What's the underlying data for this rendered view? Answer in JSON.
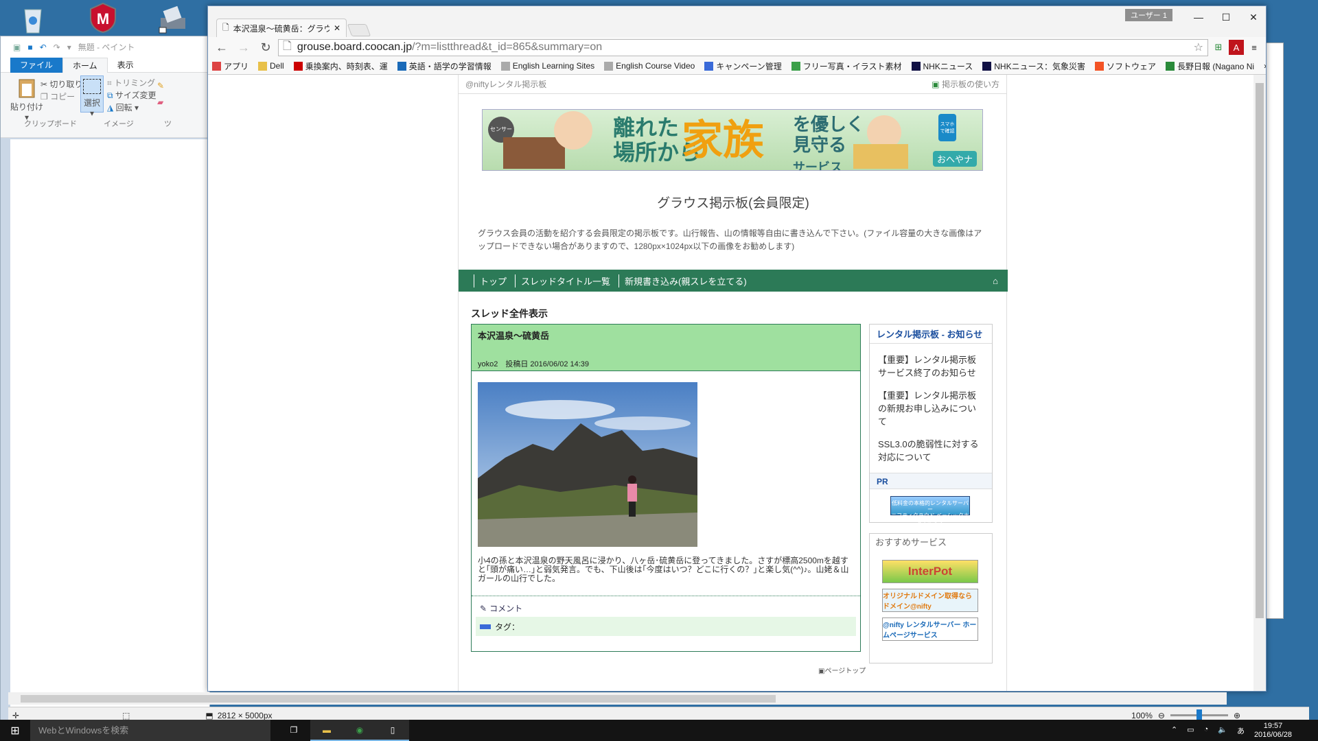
{
  "paint": {
    "title": "無題 - ペイント",
    "tabs": [
      "ファイル",
      "ホーム",
      "表示"
    ],
    "clipboard": {
      "paste": "貼り付け",
      "cut": "切り取り",
      "copy": "コピー",
      "group": "クリップボード"
    },
    "image": {
      "select": "選択",
      "trim": "トリミング",
      "resize": "サイズ変更",
      "rotate": "回転",
      "group": "イメージ"
    },
    "tool_group_partial": "ツ",
    "canvas_size": "2812 × 5000px",
    "zoom": "100%",
    "zoom_level": 0.5
  },
  "chrome": {
    "tab_title": "本沢温泉～硫黄岳：グラウ",
    "user": "ユーザー 1",
    "url_host": "grouse.board.coocan.jp",
    "url_path": "/?m=listthread&t_id=865&summary=on",
    "bookmarks": [
      {
        "icon": "apps-icon",
        "label": "アプリ"
      },
      {
        "icon": "folder-icon",
        "label": "Dell"
      },
      {
        "icon": "yahoo-icon",
        "label": "乗換案内、時刻表、運"
      },
      {
        "icon": "dict-icon",
        "label": "英語・語学の学習情報"
      },
      {
        "icon": "page-icon",
        "label": "English Learning Sites"
      },
      {
        "icon": "page-icon",
        "label": "English Course Video"
      },
      {
        "icon": "campaign-icon",
        "label": "キャンペーン管理"
      },
      {
        "icon": "photo-icon",
        "label": "フリー写真・イラスト素材"
      },
      {
        "icon": "nhk-icon",
        "label": "NHKニュース"
      },
      {
        "icon": "nhk-icon",
        "label": "NHKニュース：気象災害"
      },
      {
        "icon": "windows-icon",
        "label": "ソフトウェア"
      },
      {
        "icon": "news-icon",
        "label": "長野日報 (Nagano Ni"
      }
    ]
  },
  "page": {
    "topbar_left": "@niftyレンタル掲示板",
    "topbar_right": "掲示板の使い方",
    "banner": {
      "t1": "離れた",
      "t2": "場所から",
      "t3": "家族",
      "t4": "を優しく",
      "t5": "見守る",
      "t6": "サービス",
      "sensor": "センサー",
      "phone": "スマホで確認",
      "brand": "おへやナ"
    },
    "title": "グラウス掲示板(会員限定)",
    "desc": "グラウス会員の活動を紹介する会員限定の掲示板です。山行報告、山の情報等自由に書き込んで下さい。(ファイル容量の大きな画像はアップロードできない場合がありますので、1280px×1024px以下の画像をお勧めします)",
    "nav": [
      "トップ",
      "スレッドタイトル一覧",
      "新規書き込み(親スレを立てる)"
    ],
    "section": "スレッド全件表示",
    "post": {
      "title": "本沢温泉～硫黄岳",
      "meta": "yoko2　投稿日 2016/06/02 14:39",
      "body": "小4の孫と本沢温泉の野天風呂に浸かり、八ヶ岳･硫黄岳に登ってきました。さすが標高2500mを越すと｢頭が痛い…｣と弱気発言。でも、下山後は｢今度はいつ？どこに行くの？｣と楽し気(^^)♪。山姥＆山ガールの山行でした。",
      "comment": "コメント",
      "tag": "タグ："
    },
    "pagetop": "ページトップ",
    "notice": {
      "header": "レンタル掲示板 - お知らせ",
      "items": [
        "【重要】レンタル掲示板サービス終了のお知らせ",
        "【重要】レンタル掲示板の新規お申し込みについて",
        "SSL3.0の脆弱性に対する対応について"
      ],
      "pr": "PR",
      "pr_banner_1": "低料金の本格的レンタルサーバー",
      "pr_banner_2": "ニフティクラウド ベーシックホスティング"
    },
    "recommend": {
      "header": "おすすめサービス",
      "banners": [
        "InterPot",
        "オリジナルドメイン取得なら ドメイン@nifty",
        "@nifty レンタルサーバー ホームページサービス"
      ]
    }
  },
  "taskbar": {
    "search": "WebとWindowsを検索",
    "time": "19:57",
    "date": "2016/06/28"
  }
}
